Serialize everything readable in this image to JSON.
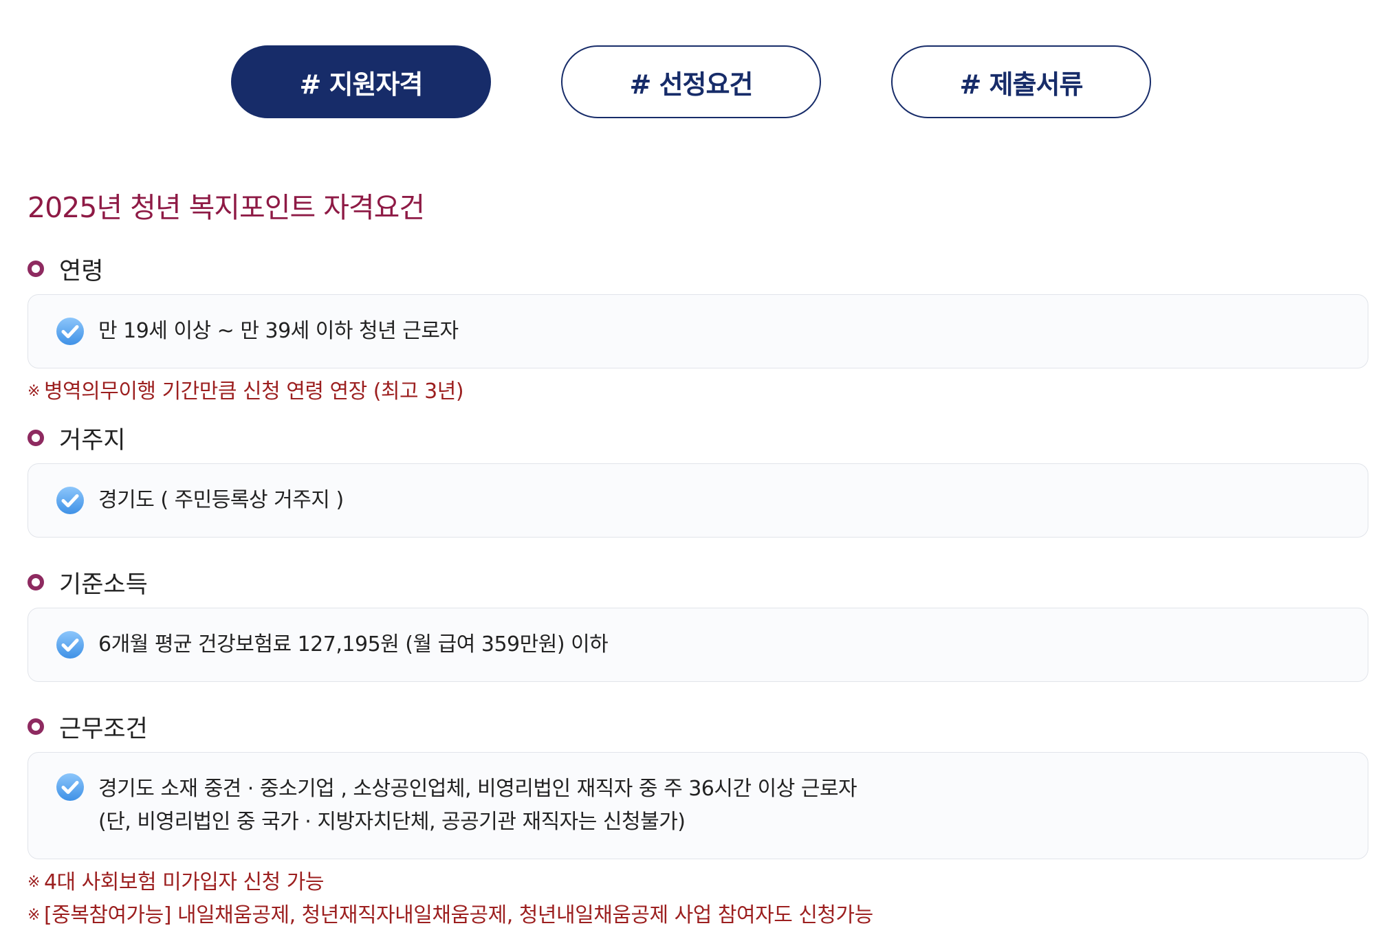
{
  "tabs": [
    {
      "label": "# 지원자격",
      "active": true
    },
    {
      "label": "# 선정요건",
      "active": false
    },
    {
      "label": "# 제출서류",
      "active": false
    }
  ],
  "title": "2025년 청년 복지포인트 자격요건",
  "note_mark": "※",
  "sections": {
    "age": {
      "heading": "연령",
      "lines": [
        "만 19세 이상 ~ 만 39세 이하 청년 근로자"
      ],
      "notes": [
        "병역의무이행 기간만큼 신청 연령 연장 (최고 3년)"
      ]
    },
    "residence": {
      "heading": "거주지",
      "lines": [
        "경기도 ( 주민등록상 거주지 )"
      ]
    },
    "income": {
      "heading": "기준소득",
      "lines": [
        "6개월 평균 건강보험료 127,195원 (월 급여 359만원) 이하"
      ]
    },
    "work": {
      "heading": "근무조건",
      "lines": [
        "경기도 소재 중견 · 중소기업 , 소상공인업체, 비영리법인 재직자 중 주 36시간 이상 근로자",
        "(단, 비영리법인 중 국가 · 지방자치단체, 공공기관 재직자는 신청불가)"
      ],
      "notes": [
        "4대 사회보험 미가입자 신청 가능",
        "[중복참여가능] 내일채움공제, 청년재직자내일채움공제, 청년내일채움공제 사업 참여자도 신청가능"
      ]
    }
  },
  "colors": {
    "navy": "#172c69",
    "title": "#8e1a45",
    "bullet": "#8e2a60",
    "note": "#9c1f1f",
    "check": "#5aa9f0"
  },
  "icons": {
    "bullet": "ring-bullet-icon",
    "check": "check-circle-icon"
  }
}
